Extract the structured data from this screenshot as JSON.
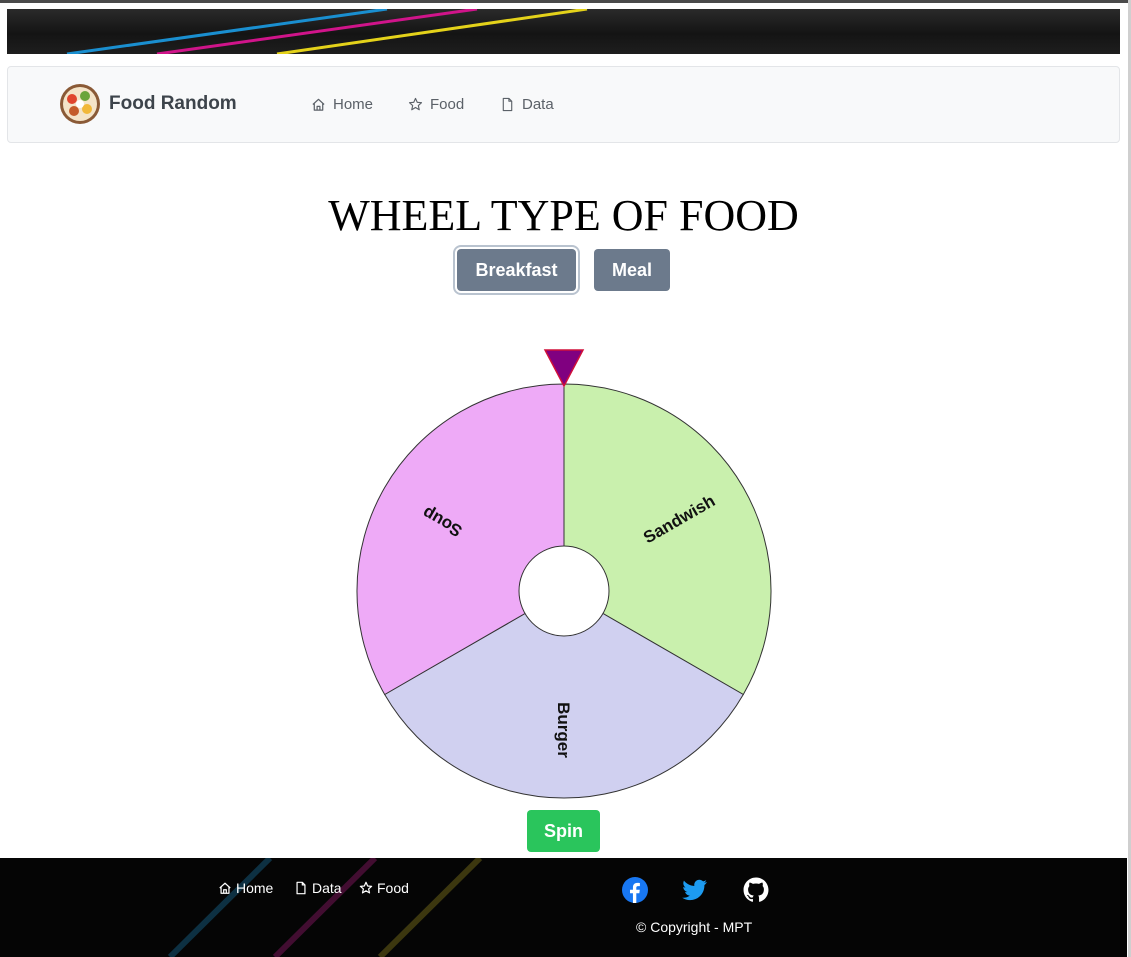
{
  "navbar": {
    "brand": "Food Random",
    "items": [
      {
        "label": "Home",
        "icon": "home-icon"
      },
      {
        "label": "Food",
        "icon": "star-icon"
      },
      {
        "label": "Data",
        "icon": "file-icon"
      }
    ]
  },
  "main": {
    "title": "WHEEL TYPE OF FOOD",
    "type_buttons": [
      {
        "label": "Breakfast",
        "active": true
      },
      {
        "label": "Meal",
        "active": false
      }
    ],
    "wheel": {
      "segments": [
        {
          "label": "Sandwish",
          "color": "#c9f0ad"
        },
        {
          "label": "Burger",
          "color": "#d0d0f0"
        },
        {
          "label": "Soup",
          "color": "#eeaaf7"
        }
      ],
      "pointer_color": "#800080"
    },
    "spin_label": "Spin"
  },
  "footer": {
    "links": [
      {
        "label": "Home",
        "icon": "home-icon"
      },
      {
        "label": "Data",
        "icon": "file-icon"
      },
      {
        "label": "Food",
        "icon": "star-icon"
      }
    ],
    "social": [
      "facebook-icon",
      "twitter-icon",
      "github-icon"
    ],
    "copyright": "© Copyright - MPT"
  },
  "colors": {
    "type_button": "#6c7a8c",
    "spin_button": "#2ac55c",
    "facebook": "#1877f2",
    "twitter": "#1d9bf0"
  }
}
